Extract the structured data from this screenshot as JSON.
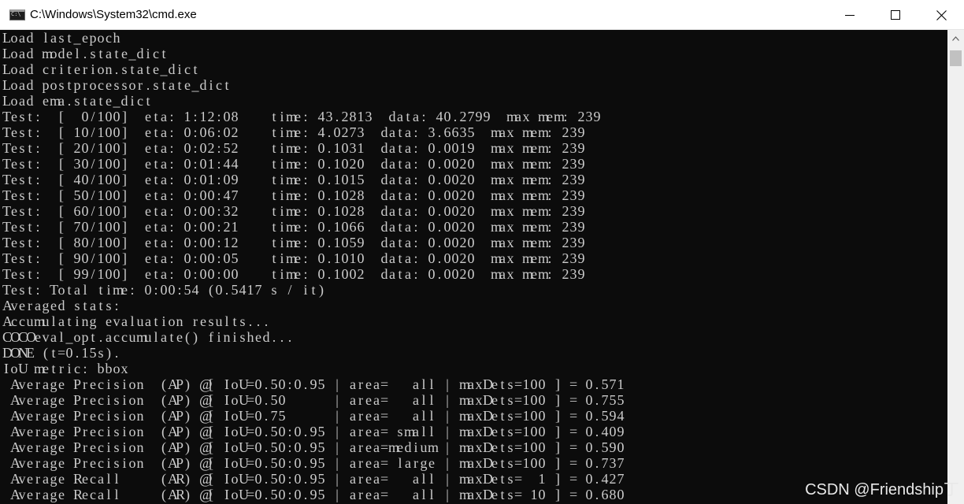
{
  "window": {
    "title": "C:\\Windows\\System32\\cmd.exe",
    "icon": "cmd-console-icon",
    "controls": [
      "minimize-icon",
      "maximize-icon",
      "close-icon"
    ]
  },
  "console": {
    "lines": [
      "Load last_epoch",
      "Load model.state_dict",
      "Load criterion.state_dict",
      "Load postprocessor.state_dict",
      "Load ema.state_dict",
      "Test:  [  0/100]  eta: 1:12:08    time: 43.2813  data: 40.2799  max mem: 239",
      "Test:  [ 10/100]  eta: 0:06:02    time: 4.0273  data: 3.6635  max mem: 239",
      "Test:  [ 20/100]  eta: 0:02:52    time: 0.1031  data: 0.0019  max mem: 239",
      "Test:  [ 30/100]  eta: 0:01:44    time: 0.1020  data: 0.0020  max mem: 239",
      "Test:  [ 40/100]  eta: 0:01:09    time: 0.1015  data: 0.0020  max mem: 239",
      "Test:  [ 50/100]  eta: 0:00:47    time: 0.1028  data: 0.0020  max mem: 239",
      "Test:  [ 60/100]  eta: 0:00:32    time: 0.1028  data: 0.0020  max mem: 239",
      "Test:  [ 70/100]  eta: 0:00:21    time: 0.1066  data: 0.0020  max mem: 239",
      "Test:  [ 80/100]  eta: 0:00:12    time: 0.1059  data: 0.0020  max mem: 239",
      "Test:  [ 90/100]  eta: 0:00:05    time: 0.1010  data: 0.0020  max mem: 239",
      "Test:  [ 99/100]  eta: 0:00:00    time: 0.1002  data: 0.0020  max mem: 239",
      "Test: Total time: 0:00:54 (0.5417 s / it)",
      "Averaged stats:",
      "Accumulating evaluation results...",
      "COCOeval_opt.accumulate() finished...",
      "DONE (t=0.15s).",
      "IoU metric: bbox",
      " Average Precision  (AP) @[ IoU=0.50:0.95 | area=   all | maxDets=100 ] = 0.571",
      " Average Precision  (AP) @[ IoU=0.50      | area=   all | maxDets=100 ] = 0.755",
      " Average Precision  (AP) @[ IoU=0.75      | area=   all | maxDets=100 ] = 0.594",
      " Average Precision  (AP) @[ IoU=0.50:0.95 | area= small | maxDets=100 ] = 0.409",
      " Average Precision  (AP) @[ IoU=0.50:0.95 | area=medium | maxDets=100 ] = 0.590",
      " Average Precision  (AP) @[ IoU=0.50:0.95 | area= large | maxDets=100 ] = 0.737",
      " Average Recall     (AR) @[ IoU=0.50:0.95 | area=   all | maxDets=  1 ] = 0.427",
      " Average Recall     (AR) @[ IoU=0.50:0.95 | area=   all | maxDets= 10 ] = 0.680"
    ]
  },
  "watermark": "CSDN @Friendship丁",
  "colors": {
    "console_bg": "#0c0c0c",
    "console_text": "#cccccc",
    "titlebar_bg": "#ffffff"
  }
}
